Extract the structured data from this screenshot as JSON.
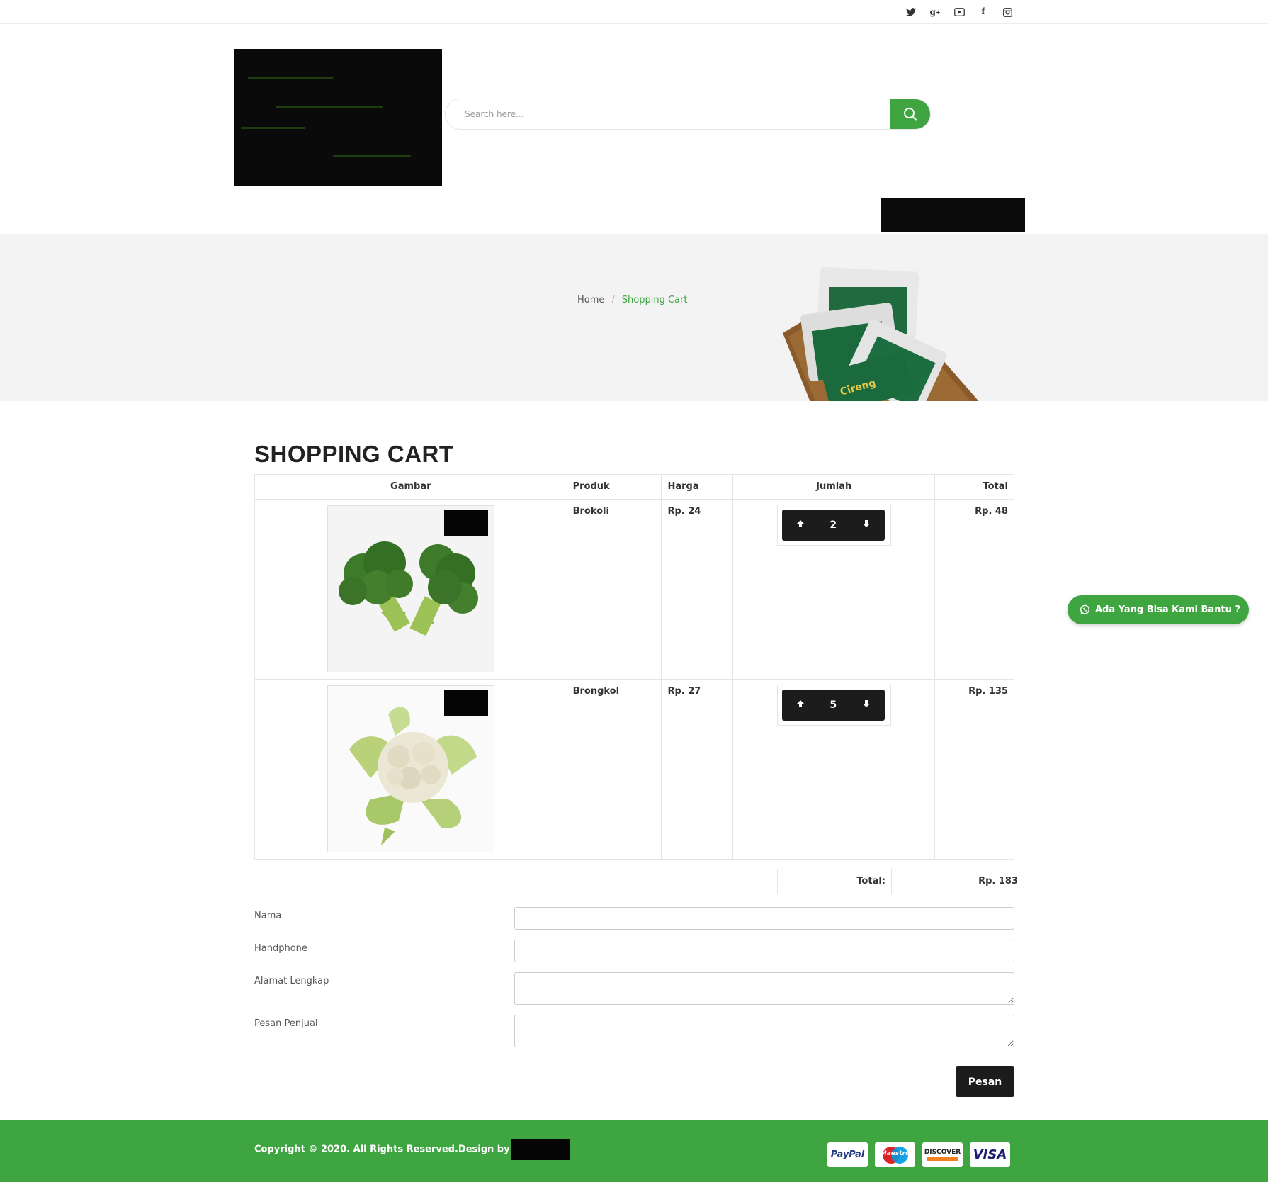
{
  "search": {
    "placeholder": "Search here..."
  },
  "social": [
    "twitter-icon",
    "google-plus-icon",
    "youtube-icon",
    "facebook-icon",
    "instagram-icon"
  ],
  "breadcrumb": {
    "home": "Home",
    "separator": "/",
    "current": "Shopping Cart"
  },
  "page_title": "SHOPPING CART",
  "table": {
    "headers": {
      "image": "Gambar",
      "product": "Produk",
      "price": "Harga",
      "qty": "Jumlah",
      "total": "Total"
    },
    "rows": [
      {
        "product": "Brokoli",
        "price": "Rp. 24",
        "qty": "2",
        "total": "Rp. 48"
      },
      {
        "product": "Brongkol",
        "price": "Rp. 27",
        "qty": "5",
        "total": "Rp. 135"
      }
    ]
  },
  "summary": {
    "label": "Total:",
    "value": "Rp. 183"
  },
  "form": {
    "name_label": "Nama",
    "phone_label": "Handphone",
    "address_label": "Alamat Lengkap",
    "message_label": "Pesan Penjual",
    "submit_label": "Pesan"
  },
  "whatsapp": {
    "label": "Ada Yang Bisa Kami Bantu ?"
  },
  "footer": {
    "copyright": "Copyright © 2020. All Rights Reserved.Design by",
    "payments": [
      "PayPal",
      "Maestro",
      "DISCOVER",
      "VISA"
    ]
  },
  "colors": {
    "accent": "#3ea540",
    "dark": "#1c1c1c",
    "banner_bg": "#f3f3f3"
  }
}
